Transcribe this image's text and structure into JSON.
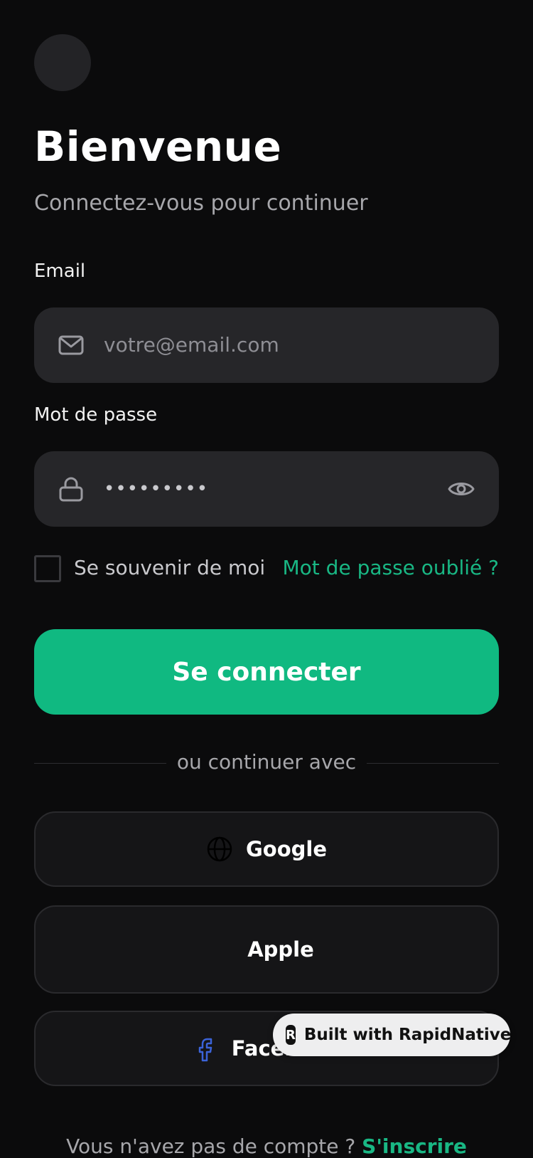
{
  "header": {
    "title": "Bienvenue",
    "subtitle": "Connectez-vous pour continuer"
  },
  "email": {
    "label": "Email",
    "placeholder": "votre@email.com",
    "icon": "mail-icon"
  },
  "password": {
    "label": "Mot de passe",
    "value": "•••••••••",
    "icon": "lock-icon",
    "toggle_icon": "eye-icon"
  },
  "remember": {
    "label": "Se souvenir de moi",
    "checked": false
  },
  "forgot_link": "Mot de passe oublié ?",
  "primary_button": "Se connecter",
  "divider_text": "ou continuer avec",
  "social": {
    "google": "Google",
    "apple": "Apple",
    "facebook": "Facebook"
  },
  "badge": "Built with RapidNative",
  "footer": {
    "prompt": "Vous n'avez pas de compte ?",
    "signup": "S'inscrire"
  },
  "colors": {
    "background": "#0b0b0c",
    "accent": "#10b981",
    "field_bg": "#262629",
    "facebook_blue": "#3b63d8"
  }
}
